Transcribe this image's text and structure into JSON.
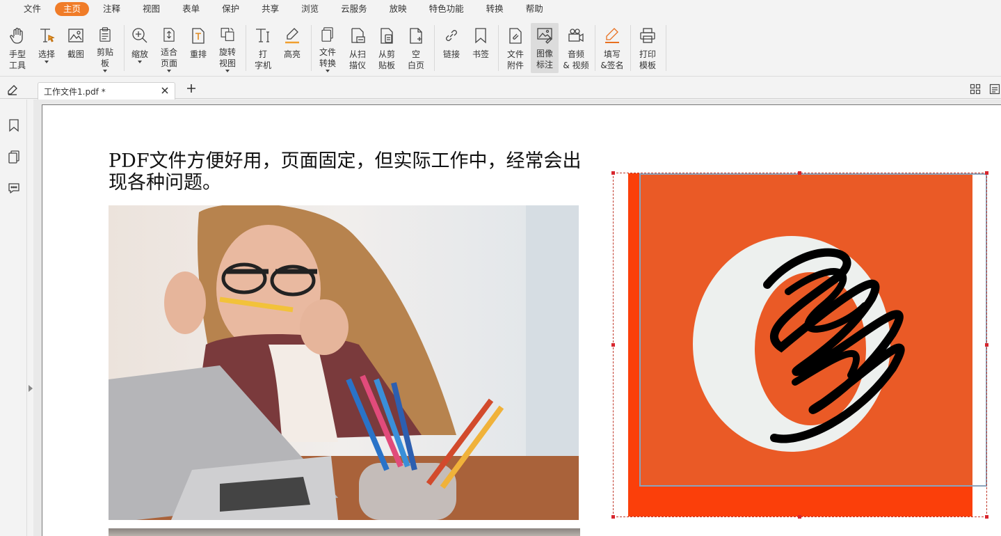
{
  "menu": {
    "items": [
      {
        "label": "文件",
        "active": false
      },
      {
        "label": "主页",
        "active": true
      },
      {
        "label": "注释",
        "active": false
      },
      {
        "label": "视图",
        "active": false
      },
      {
        "label": "表单",
        "active": false
      },
      {
        "label": "保护",
        "active": false
      },
      {
        "label": "共享",
        "active": false
      },
      {
        "label": "浏览",
        "active": false
      },
      {
        "label": "云服务",
        "active": false
      },
      {
        "label": "放映",
        "active": false
      },
      {
        "label": "特色功能",
        "active": false
      },
      {
        "label": "转换",
        "active": false
      },
      {
        "label": "帮助",
        "active": false
      }
    ],
    "accent_color": "#f07c28"
  },
  "ribbon": {
    "hand": "手型\n工具",
    "select": "选择",
    "screenshot": "截图",
    "clipboard": "剪贴\n板",
    "zoom": "缩放",
    "fit_page": "适合\n页面",
    "reflow": "重排",
    "rotate": "旋转\n视图",
    "typewriter": "打\n字机",
    "highlight": "高亮",
    "file_convert": "文件\n转换",
    "scanner": "从扫\n描仪",
    "from_clipboard": "从剪\n贴板",
    "blank_page": "空\n白页",
    "link": "链接",
    "bookmark": "书签",
    "attachment": "文件\n附件",
    "image_annot": "图像\n标注",
    "audio_video": "音频\n& 视频",
    "fill_sign": "填写\n&签名",
    "print_template": "打印\n模板"
  },
  "tabs": {
    "active_title": "工作文件1.pdf *"
  },
  "document": {
    "heading": "PDF文件方便好用，页面固定，但实际工作中，经常会出现各种问题。"
  }
}
